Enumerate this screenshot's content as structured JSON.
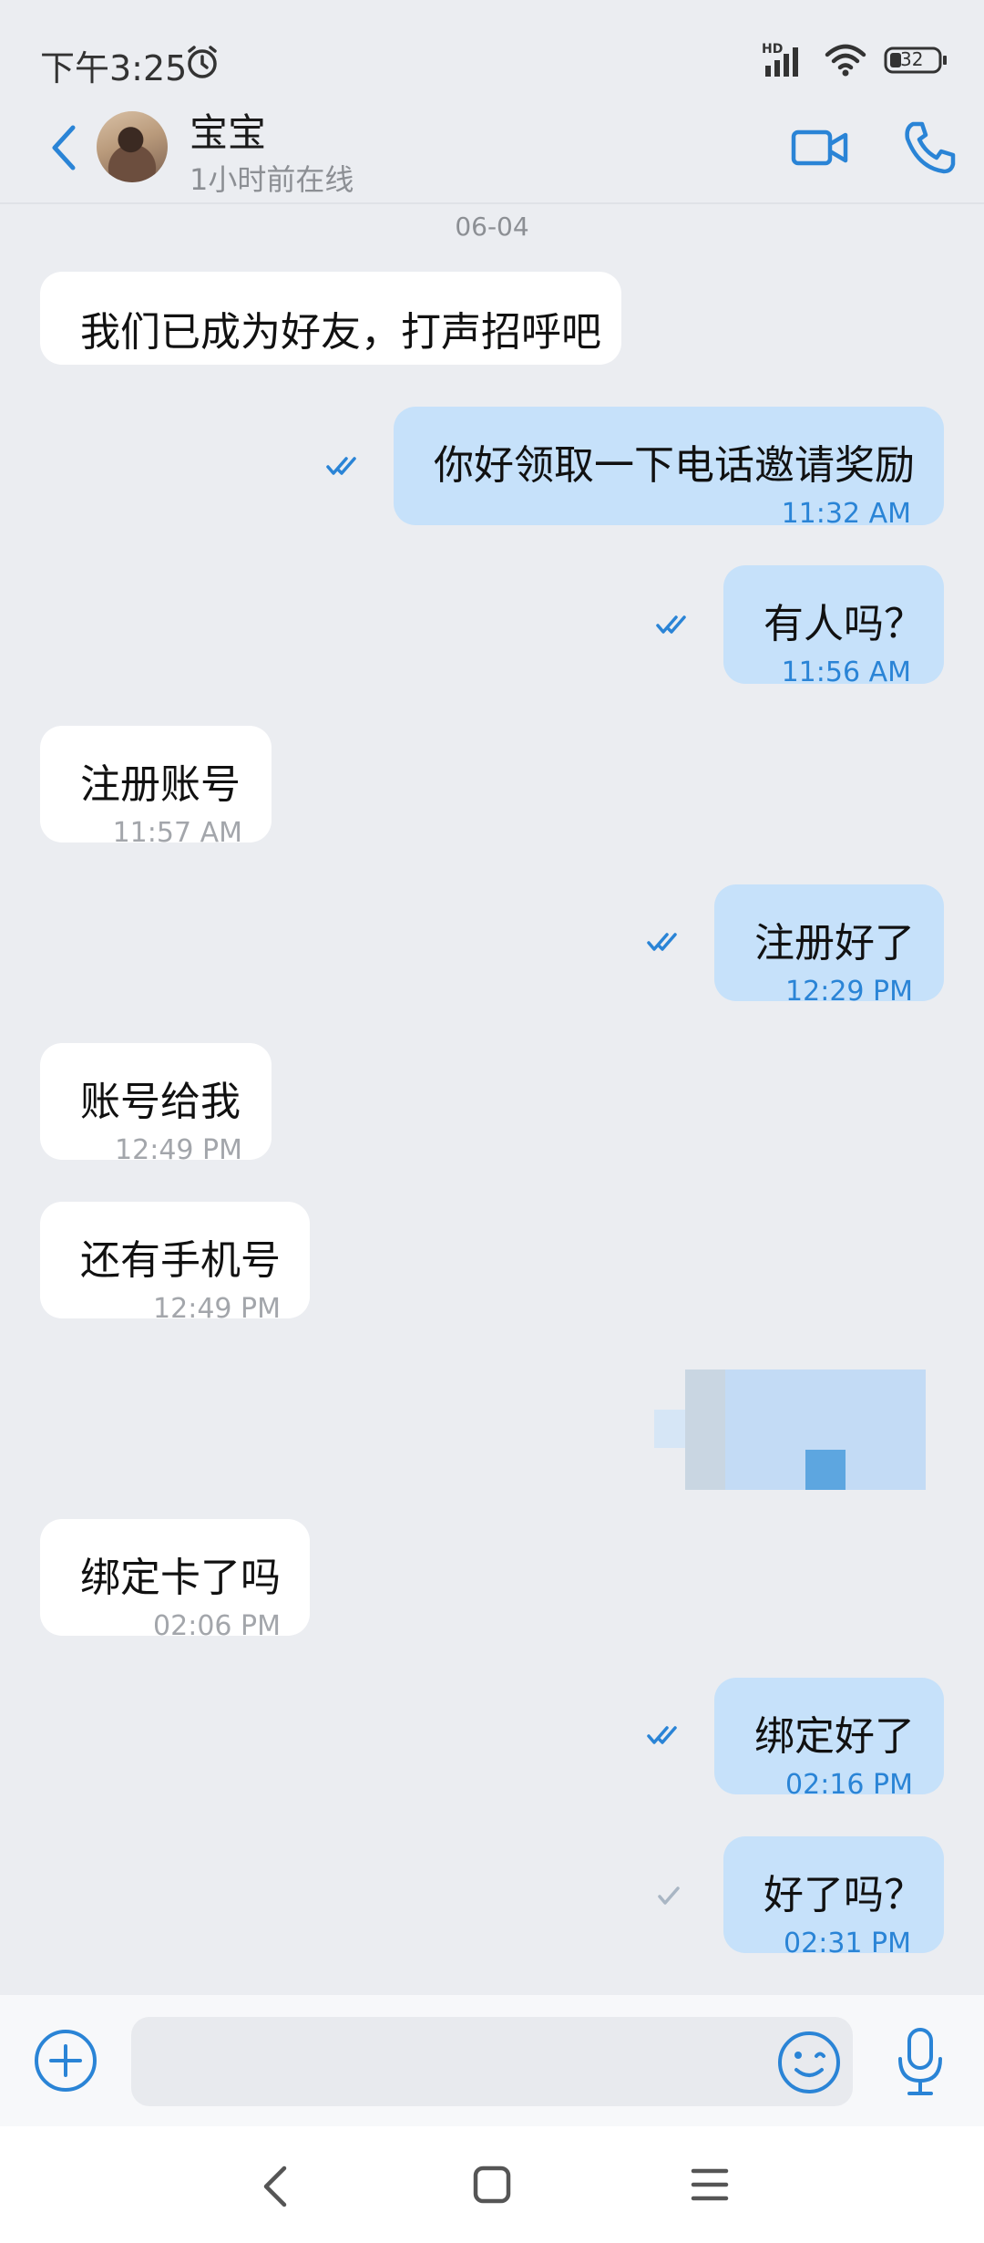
{
  "status_bar": {
    "time": "下午3:25",
    "network": "HD",
    "battery": "32"
  },
  "header": {
    "contact_name": "宝宝",
    "contact_status": "1小时前在线"
  },
  "chat": {
    "date": "06-04",
    "messages": [
      {
        "direction": "in",
        "text": "我们已成为好友，打声招呼吧",
        "time": ""
      },
      {
        "direction": "out",
        "text": "你好领取一下电话邀请奖励",
        "time": "11:32 AM",
        "ticks": "double"
      },
      {
        "direction": "out",
        "text": "有人吗？",
        "time": "11:56 AM",
        "ticks": "double"
      },
      {
        "direction": "in",
        "text": "注册账号",
        "time": "11:57 AM"
      },
      {
        "direction": "out",
        "text": "注册好了",
        "time": "12:29 PM",
        "ticks": "double"
      },
      {
        "direction": "in",
        "text": "账号给我",
        "time": "12:49 PM"
      },
      {
        "direction": "in",
        "text": "还有手机号",
        "time": "12:49 PM"
      },
      {
        "direction": "out",
        "type": "image"
      },
      {
        "direction": "in",
        "text": "绑定卡了吗",
        "time": "02:06 PM"
      },
      {
        "direction": "out",
        "text": "绑定好了",
        "time": "02:16 PM",
        "ticks": "double"
      },
      {
        "direction": "out",
        "text": "好了吗？",
        "time": "02:31 PM",
        "ticks": "single"
      }
    ]
  },
  "input": {
    "placeholder": ""
  },
  "colors": {
    "accent": "#2a84d6",
    "outgoing_bubble": "#c6e1fa",
    "incoming_bubble": "#ffffff",
    "background": "#ebedf1"
  }
}
